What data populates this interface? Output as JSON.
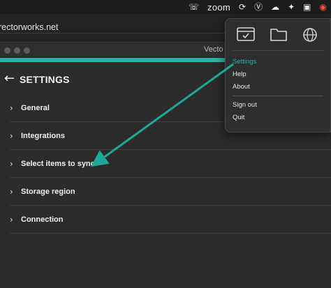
{
  "menubar": {
    "zoom_label": "zoom",
    "icons": [
      "viber-icon",
      "zoom-icon",
      "sync-icon",
      "vpn-icon",
      "cloud-icon",
      "bird-icon",
      "gpu-icon",
      "record-icon"
    ]
  },
  "browser": {
    "url": "rectorworks.net"
  },
  "window": {
    "title": "Vecto",
    "header": "SETTINGS",
    "rows": [
      {
        "label": "General"
      },
      {
        "label": "Integrations"
      },
      {
        "label": "Select items to sync"
      },
      {
        "label": "Storage region"
      },
      {
        "label": "Connection"
      }
    ]
  },
  "popup": {
    "icons": [
      "browser-window-icon",
      "folder-icon",
      "globe-icon"
    ],
    "items": [
      {
        "label": "Settings"
      },
      {
        "label": "Help"
      },
      {
        "label": "About"
      },
      {
        "label": "Sign out"
      },
      {
        "label": "Quit"
      }
    ]
  },
  "colors": {
    "accent": "#2bb3a3",
    "background": "#2b2b2b",
    "menubar": "#1c1c1e"
  }
}
